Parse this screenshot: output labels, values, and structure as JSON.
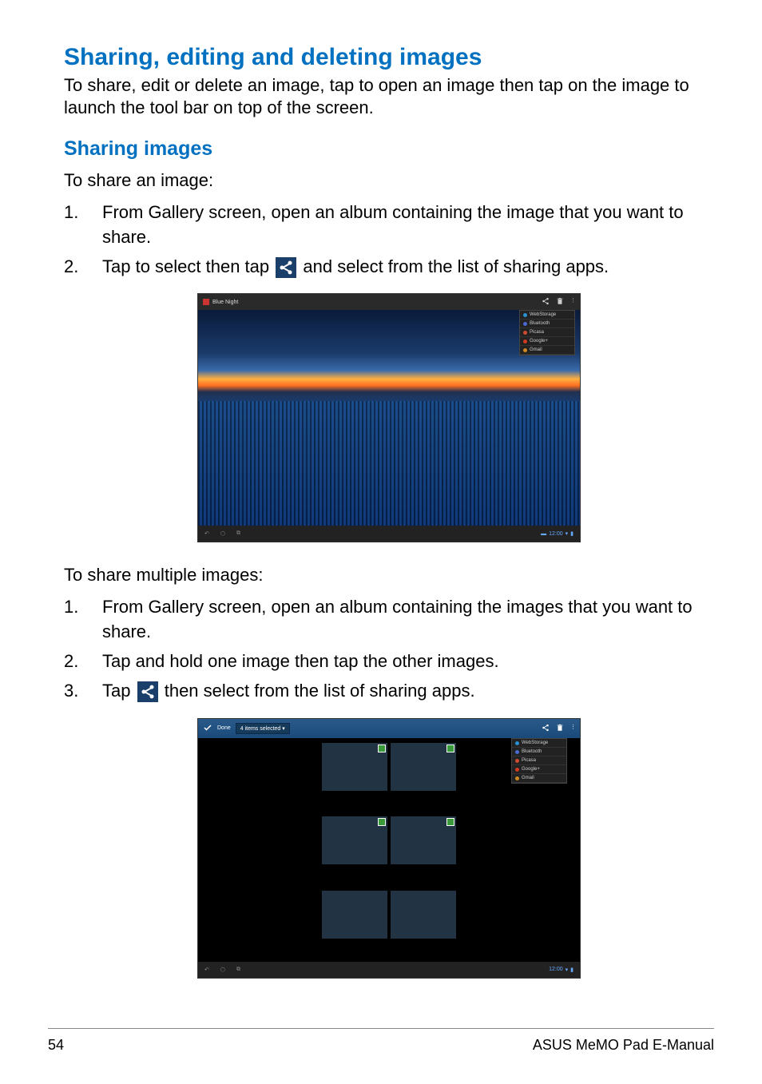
{
  "h2": "Sharing, editing and deleting images",
  "intro": "To share, edit or delete an image, tap to open an image then tap on the image to launch the tool bar on top of the screen.",
  "h3": "Sharing images",
  "lead1": "To share an image:",
  "list1": {
    "i1": "From Gallery screen, open an album containing the image that you want to share.",
    "i2a": "Tap to select then tap ",
    "i2b": " and select from the list of sharing apps."
  },
  "lead2": "To share multiple images:",
  "list2": {
    "i1": "From Gallery screen, open an album containing the images that you want to share.",
    "i2": "Tap and hold one image then tap the other images.",
    "i3a": "Tap ",
    "i3b": " then select from the list of sharing apps."
  },
  "ss1": {
    "album": "Blue Night",
    "menu": [
      {
        "label": "WebStorage",
        "color": "#2a90d0"
      },
      {
        "label": "Bluetooth",
        "color": "#4a6ad0"
      },
      {
        "label": "Picasa",
        "color": "#d04a30"
      },
      {
        "label": "Google+",
        "color": "#d03a20"
      },
      {
        "label": "Gmail",
        "color": "#d08a20"
      }
    ],
    "clock": "12:00"
  },
  "ss2": {
    "done": "Done",
    "selected": "4 items selected",
    "menu": [
      {
        "label": "WebStorage",
        "color": "#2a90d0"
      },
      {
        "label": "Bluetooth",
        "color": "#4a6ad0"
      },
      {
        "label": "Picasa",
        "color": "#d04a30"
      },
      {
        "label": "Google+",
        "color": "#d03a20"
      },
      {
        "label": "Gmail",
        "color": "#d08a20"
      }
    ],
    "clock": "12:00"
  },
  "footer": {
    "page": "54",
    "title": "ASUS MeMO Pad E-Manual"
  }
}
